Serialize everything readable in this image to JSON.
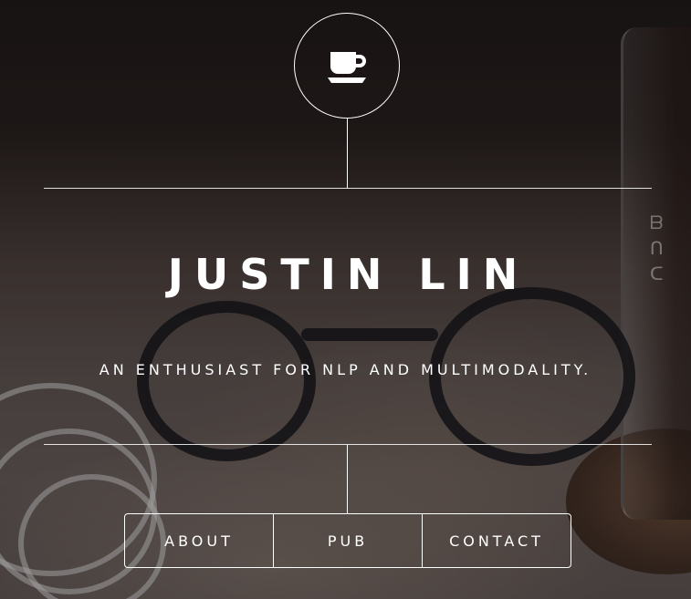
{
  "header": {
    "logo_icon": "coffee-cup-icon",
    "title": "JUSTIN LIN",
    "tagline": "AN ENTHUSIAST FOR NLP AND MULTIMODALITY."
  },
  "nav": {
    "items": [
      {
        "label": "ABOUT"
      },
      {
        "label": "PUB"
      },
      {
        "label": "CONTACT"
      }
    ]
  },
  "colors": {
    "text": "#ffffff",
    "lines": "#ffffff",
    "background": "#3a3230"
  }
}
